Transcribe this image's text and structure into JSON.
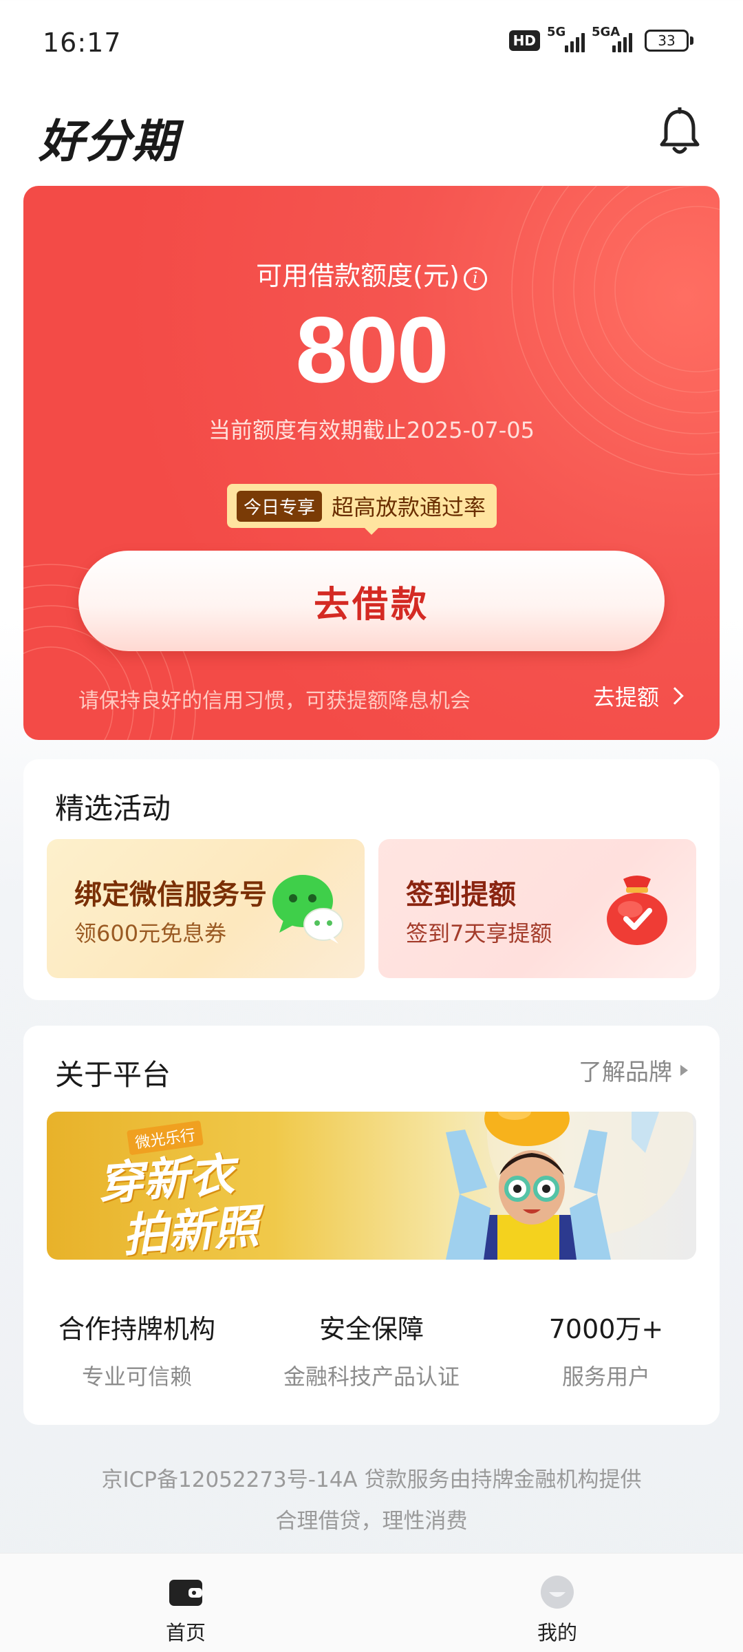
{
  "status_bar": {
    "time": "16:17",
    "hd": "HD",
    "signal_1": "5G",
    "signal_2": "5GA",
    "battery": "33"
  },
  "header": {
    "logo": "好分期",
    "bell_icon": "bell-icon"
  },
  "credit": {
    "limit_label": "可用借款额度(元)",
    "info_icon_glyph": "i",
    "amount": "800",
    "expiry": "当前额度有效期截止2025-07-05",
    "promo_badge": "今日专享",
    "promo_text": "超高放款通过率",
    "borrow_button": "去借款",
    "tip": "请保持良好的信用习惯，可获提额降息机会",
    "raise_link": "去提额",
    "card_color": "#f34b47"
  },
  "activities": {
    "title": "精选活动",
    "items": [
      {
        "title": "绑定微信服务号",
        "subtitle": "领600元免息券",
        "icon": "wechat-icon"
      },
      {
        "title": "签到提额",
        "subtitle": "签到7天享提额",
        "icon": "lucky-bag-check-icon"
      }
    ]
  },
  "about": {
    "title": "关于平台",
    "brand_link": "了解品牌",
    "banner": {
      "ribbon": "微光乐行",
      "line1": "穿新衣",
      "line2": "拍新照"
    },
    "stats": [
      {
        "title": "合作持牌机构",
        "subtitle": "专业可信赖"
      },
      {
        "title": "安全保障",
        "subtitle": "金融科技产品认证"
      },
      {
        "title": "7000万+",
        "subtitle": "服务用户"
      }
    ]
  },
  "footer": {
    "line1": "京ICP备12052273号-14A 贷款服务由持牌金融机构提供",
    "line2": "合理借贷，理性消费"
  },
  "bottom_nav": {
    "items": [
      {
        "label": "首页",
        "icon": "wallet-icon",
        "active": true
      },
      {
        "label": "我的",
        "icon": "profile-face-icon",
        "active": false
      }
    ]
  }
}
